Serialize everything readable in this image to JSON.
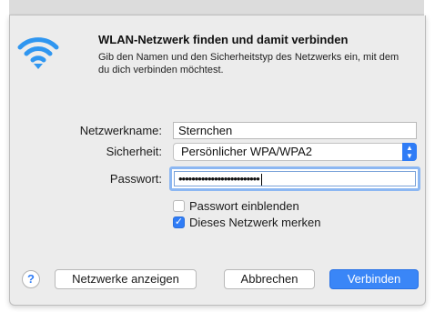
{
  "dialog": {
    "title": "WLAN-Netzwerk finden und damit verbinden",
    "description": "Gib den Namen und den Sicherheitstyp des Netzwerks ein, mit dem du dich verbinden möchtest.",
    "icon": "wifi-icon",
    "accent_color": "#2f7cf6"
  },
  "form": {
    "network_label": "Netzwerkname:",
    "network_value": "Sternchen",
    "security_label": "Sicherheit:",
    "security_value": "Persönlicher WPA/WPA2",
    "password_label": "Passwort:",
    "password_value": "•••••••••••••••••••••••••",
    "show_password_label": "Passwort einblenden",
    "show_password_checked": false,
    "remember_label": "Dieses Netzwerk merken",
    "remember_checked": true
  },
  "buttons": {
    "help": "?",
    "show_networks": "Netzwerke anzeigen",
    "cancel": "Abbrechen",
    "connect": "Verbinden"
  }
}
